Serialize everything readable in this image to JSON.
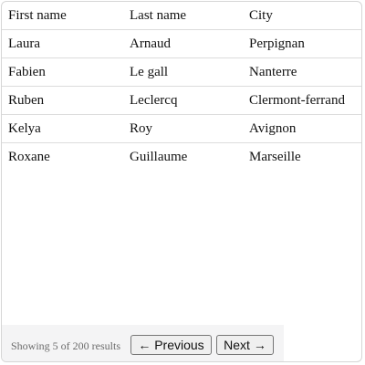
{
  "table": {
    "headers": [
      "First name",
      "Last name",
      "City"
    ],
    "rows": [
      [
        "Laura",
        "Arnaud",
        "Perpignan"
      ],
      [
        "Fabien",
        "Le gall",
        "Nanterre"
      ],
      [
        "Ruben",
        "Leclercq",
        "Clermont-ferrand"
      ],
      [
        "Kelya",
        "Roy",
        "Avignon"
      ],
      [
        "Roxane",
        "Guillaume",
        "Marseille"
      ]
    ]
  },
  "pagination": {
    "status": "Showing 5 of 200 results",
    "previous_label": "← Previous",
    "next_label": "Next →"
  }
}
